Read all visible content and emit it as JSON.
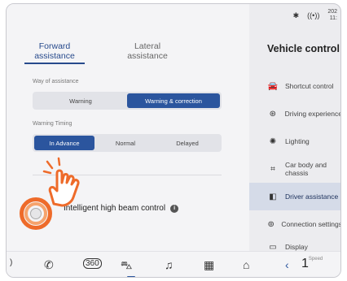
{
  "status": {
    "bluetooth": "bluetooth-icon",
    "signal": "signal-icon",
    "time_line1": "202",
    "time_line2": "11:"
  },
  "tabs": [
    {
      "label_line1": "Forward",
      "label_line2": "assistance",
      "active": true
    },
    {
      "label_line1": "Lateral",
      "label_line2": "assistance",
      "active": false
    }
  ],
  "way": {
    "label": "Way of assistance",
    "options": [
      "Warning",
      "Warning & correction"
    ],
    "selected": "Warning & correction"
  },
  "timing": {
    "label": "Warning Timing",
    "options": [
      "In Advance",
      "Normal",
      "Delayed"
    ],
    "selected": "In Advance"
  },
  "high_beam": {
    "label": "Intelligent high beam control",
    "info_icon": "i"
  },
  "vehicle": {
    "title": "Vehicle control",
    "menu": [
      {
        "icon": "car-icon",
        "glyph": "🚘",
        "label": "Shortcut control"
      },
      {
        "icon": "steering-wheel-icon",
        "glyph": "⊛",
        "label": "Driving experience"
      },
      {
        "icon": "light-icon",
        "glyph": "✺",
        "label": "Lighting"
      },
      {
        "icon": "chassis-icon",
        "glyph": "⌗",
        "label": "Car body and chassis"
      },
      {
        "icon": "driver-assist-icon",
        "glyph": "◧",
        "label": "Driver assistance"
      },
      {
        "icon": "connection-icon",
        "glyph": "⊚",
        "label": "Connection settings"
      },
      {
        "icon": "display-icon",
        "glyph": "▭",
        "label": "Display"
      }
    ],
    "active_index": 4
  },
  "bottom": {
    "items": [
      "volume-icon",
      "phone-icon",
      "360-camera-icon",
      "car-icon",
      "music-icon",
      "apps-icon",
      "home-icon"
    ],
    "speed_value": "1",
    "speed_unit": "Speed"
  }
}
